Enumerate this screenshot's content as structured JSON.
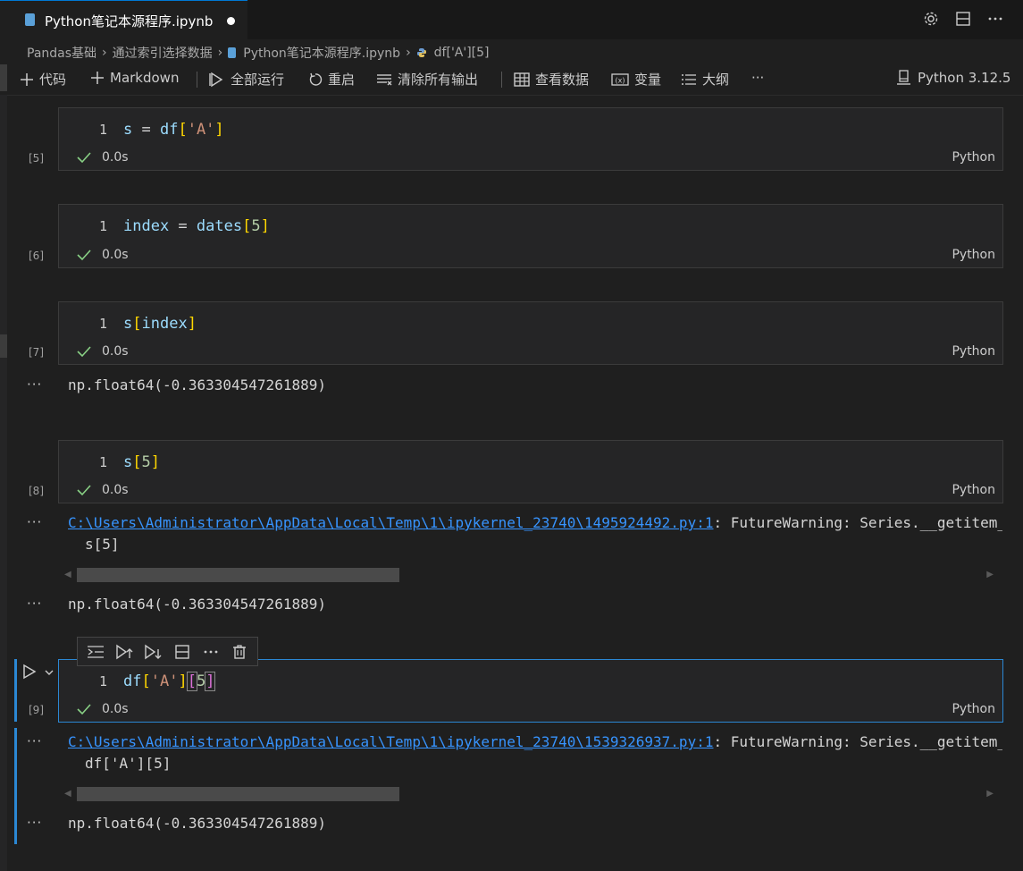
{
  "tab": {
    "title": "Python笔记本源程序.ipynb"
  },
  "breadcrumb": {
    "items": [
      "Pandas基础",
      "通过索引选择数据",
      "Python笔记本源程序.ipynb",
      "df['A'][5]"
    ]
  },
  "toolbar": {
    "code": "代码",
    "markdown": "Markdown",
    "run_all": "全部运行",
    "restart": "重启",
    "clear_outputs": "清除所有输出",
    "view_data": "查看数据",
    "variables": "变量",
    "outline": "大纲",
    "more": "···",
    "kernel": "Python 3.12.5"
  },
  "cells": [
    {
      "count": "[5]",
      "line": "1",
      "time": "0.0s",
      "lang": "Python"
    },
    {
      "count": "[6]",
      "line": "1",
      "time": "0.0s",
      "lang": "Python"
    },
    {
      "count": "[7]",
      "line": "1",
      "time": "0.0s",
      "lang": "Python"
    },
    {
      "count": "[8]",
      "line": "1",
      "time": "0.0s",
      "lang": "Python"
    },
    {
      "count": "[9]",
      "line": "1",
      "time": "0.0s",
      "lang": "Python"
    }
  ],
  "outputs": {
    "dots": "···",
    "cell7_result": "np.float64(-0.363304547261889)",
    "cell8_warning_path": "C:\\Users\\Administrator\\AppData\\Local\\Temp\\1\\ipykernel_23740\\1495924492.py:1",
    "cell8_warning_text": ": FutureWarning: Series.__getitem_",
    "cell8_warning_code": "s[5]",
    "cell8_result": "np.float64(-0.363304547261889)",
    "cell9_warning_path": "C:\\Users\\Administrator\\AppData\\Local\\Temp\\1\\ipykernel_23740\\1539326937.py:1",
    "cell9_warning_text": ": FutureWarning: Series.__getitem_",
    "cell9_warning_code": "df['A'][5]",
    "cell9_result": "np.float64(-0.363304547261889)"
  }
}
